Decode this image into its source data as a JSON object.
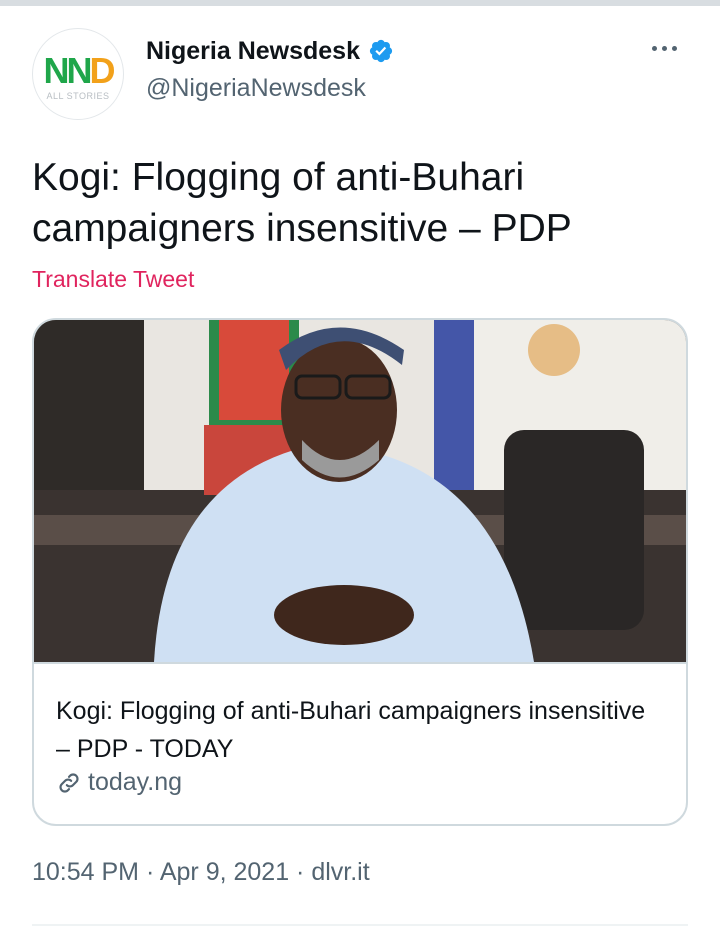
{
  "account": {
    "display_name": "Nigeria Newsdesk",
    "handle": "@NigeriaNewsdesk",
    "verified_icon": "verified-badge-icon",
    "avatar": {
      "logo_text": "NND",
      "tagline": "ALL STORIES"
    }
  },
  "tweet": {
    "text": "Kogi: Flogging of anti-Buhari campaigners insensitive – PDP",
    "translate_label": "Translate Tweet"
  },
  "card": {
    "title": "Kogi: Flogging of anti-Buhari campaigners insensitive – PDP - TODAY",
    "domain": "today.ng",
    "link_icon": "link-icon"
  },
  "meta": {
    "timestamp": "10:54 PM · Apr 9, 2021 · dlvr.it"
  },
  "colors": {
    "accent_link": "#e0245e",
    "verified": "#1d9bf0",
    "muted_text": "#536471"
  }
}
